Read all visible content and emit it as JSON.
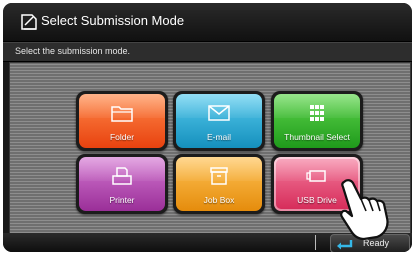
{
  "header": {
    "title": "Select Submission Mode",
    "icon": "submission-mode-icon"
  },
  "instruction": "Select the submission mode.",
  "tiles": [
    {
      "label": "Folder",
      "icon": "folder-icon",
      "color": "#f05a1f"
    },
    {
      "label": "E-mail",
      "icon": "envelope-icon",
      "color": "#2aa6cf"
    },
    {
      "label": "Thumbnail Select",
      "icon": "grid-icon",
      "color": "#36b52f"
    },
    {
      "label": "Printer",
      "icon": "printer-icon",
      "color": "#b247b0"
    },
    {
      "label": "Job Box",
      "icon": "box-icon",
      "color": "#f0a020"
    },
    {
      "label": "USB Drive",
      "icon": "usb-drive-icon",
      "color": "#e23a66",
      "state": "pressed"
    }
  ],
  "footer": {
    "status_label": "Ready",
    "status_icon": "return-arrow-icon"
  },
  "overlay": {
    "icon": "pointing-hand-icon"
  }
}
